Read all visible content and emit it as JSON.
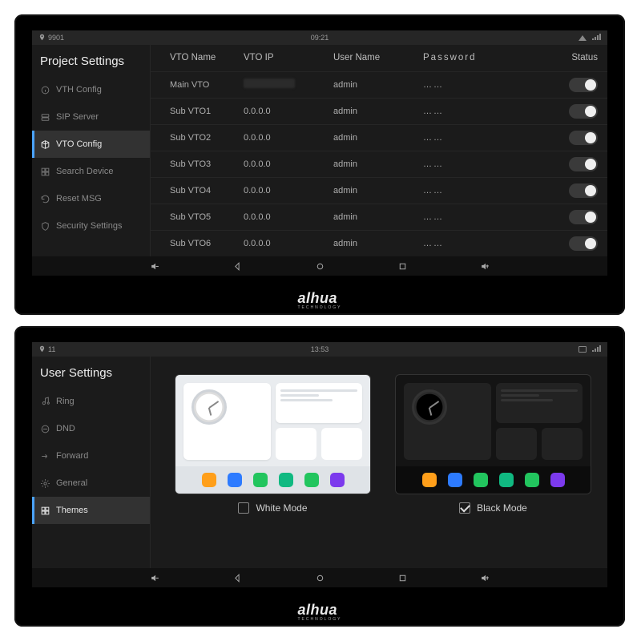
{
  "brand": "alhua",
  "brand_sub": "TECHNOLOGY",
  "panel1": {
    "status": {
      "left_id": "9901",
      "time": "09:21"
    },
    "sidebar": {
      "title": "Project Settings",
      "items": [
        {
          "label": "VTH Config"
        },
        {
          "label": "SIP Server"
        },
        {
          "label": "VTO Config"
        },
        {
          "label": "Search Device"
        },
        {
          "label": "Reset MSG"
        },
        {
          "label": "Security Settings"
        }
      ],
      "active_index": 2
    },
    "table": {
      "headers": {
        "name": "VTO Name",
        "ip": "VTO IP",
        "user": "User Name",
        "pass": "Password",
        "status": "Status"
      },
      "rows": [
        {
          "name": "Main VTO",
          "ip": "",
          "ip_blurred": true,
          "user": "admin",
          "pass": "……",
          "on": true
        },
        {
          "name": "Sub VTO1",
          "ip": "0.0.0.0",
          "ip_blurred": false,
          "user": "admin",
          "pass": "……",
          "on": true
        },
        {
          "name": "Sub VTO2",
          "ip": "0.0.0.0",
          "ip_blurred": false,
          "user": "admin",
          "pass": "……",
          "on": true
        },
        {
          "name": "Sub VTO3",
          "ip": "0.0.0.0",
          "ip_blurred": false,
          "user": "admin",
          "pass": "……",
          "on": true
        },
        {
          "name": "Sub VTO4",
          "ip": "0.0.0.0",
          "ip_blurred": false,
          "user": "admin",
          "pass": "……",
          "on": true
        },
        {
          "name": "Sub VTO5",
          "ip": "0.0.0.0",
          "ip_blurred": false,
          "user": "admin",
          "pass": "……",
          "on": true
        },
        {
          "name": "Sub VTO6",
          "ip": "0.0.0.0",
          "ip_blurred": false,
          "user": "admin",
          "pass": "……",
          "on": true
        }
      ]
    }
  },
  "panel2": {
    "status": {
      "left_id": "11",
      "time": "13:53"
    },
    "sidebar": {
      "title": "User Settings",
      "items": [
        {
          "label": "Ring"
        },
        {
          "label": "DND"
        },
        {
          "label": "Forward"
        },
        {
          "label": "General"
        },
        {
          "label": "Themes"
        }
      ],
      "active_index": 4
    },
    "themes": {
      "white": {
        "label": "White Mode",
        "checked": false
      },
      "black": {
        "label": "Black Mode",
        "checked": true
      }
    }
  }
}
